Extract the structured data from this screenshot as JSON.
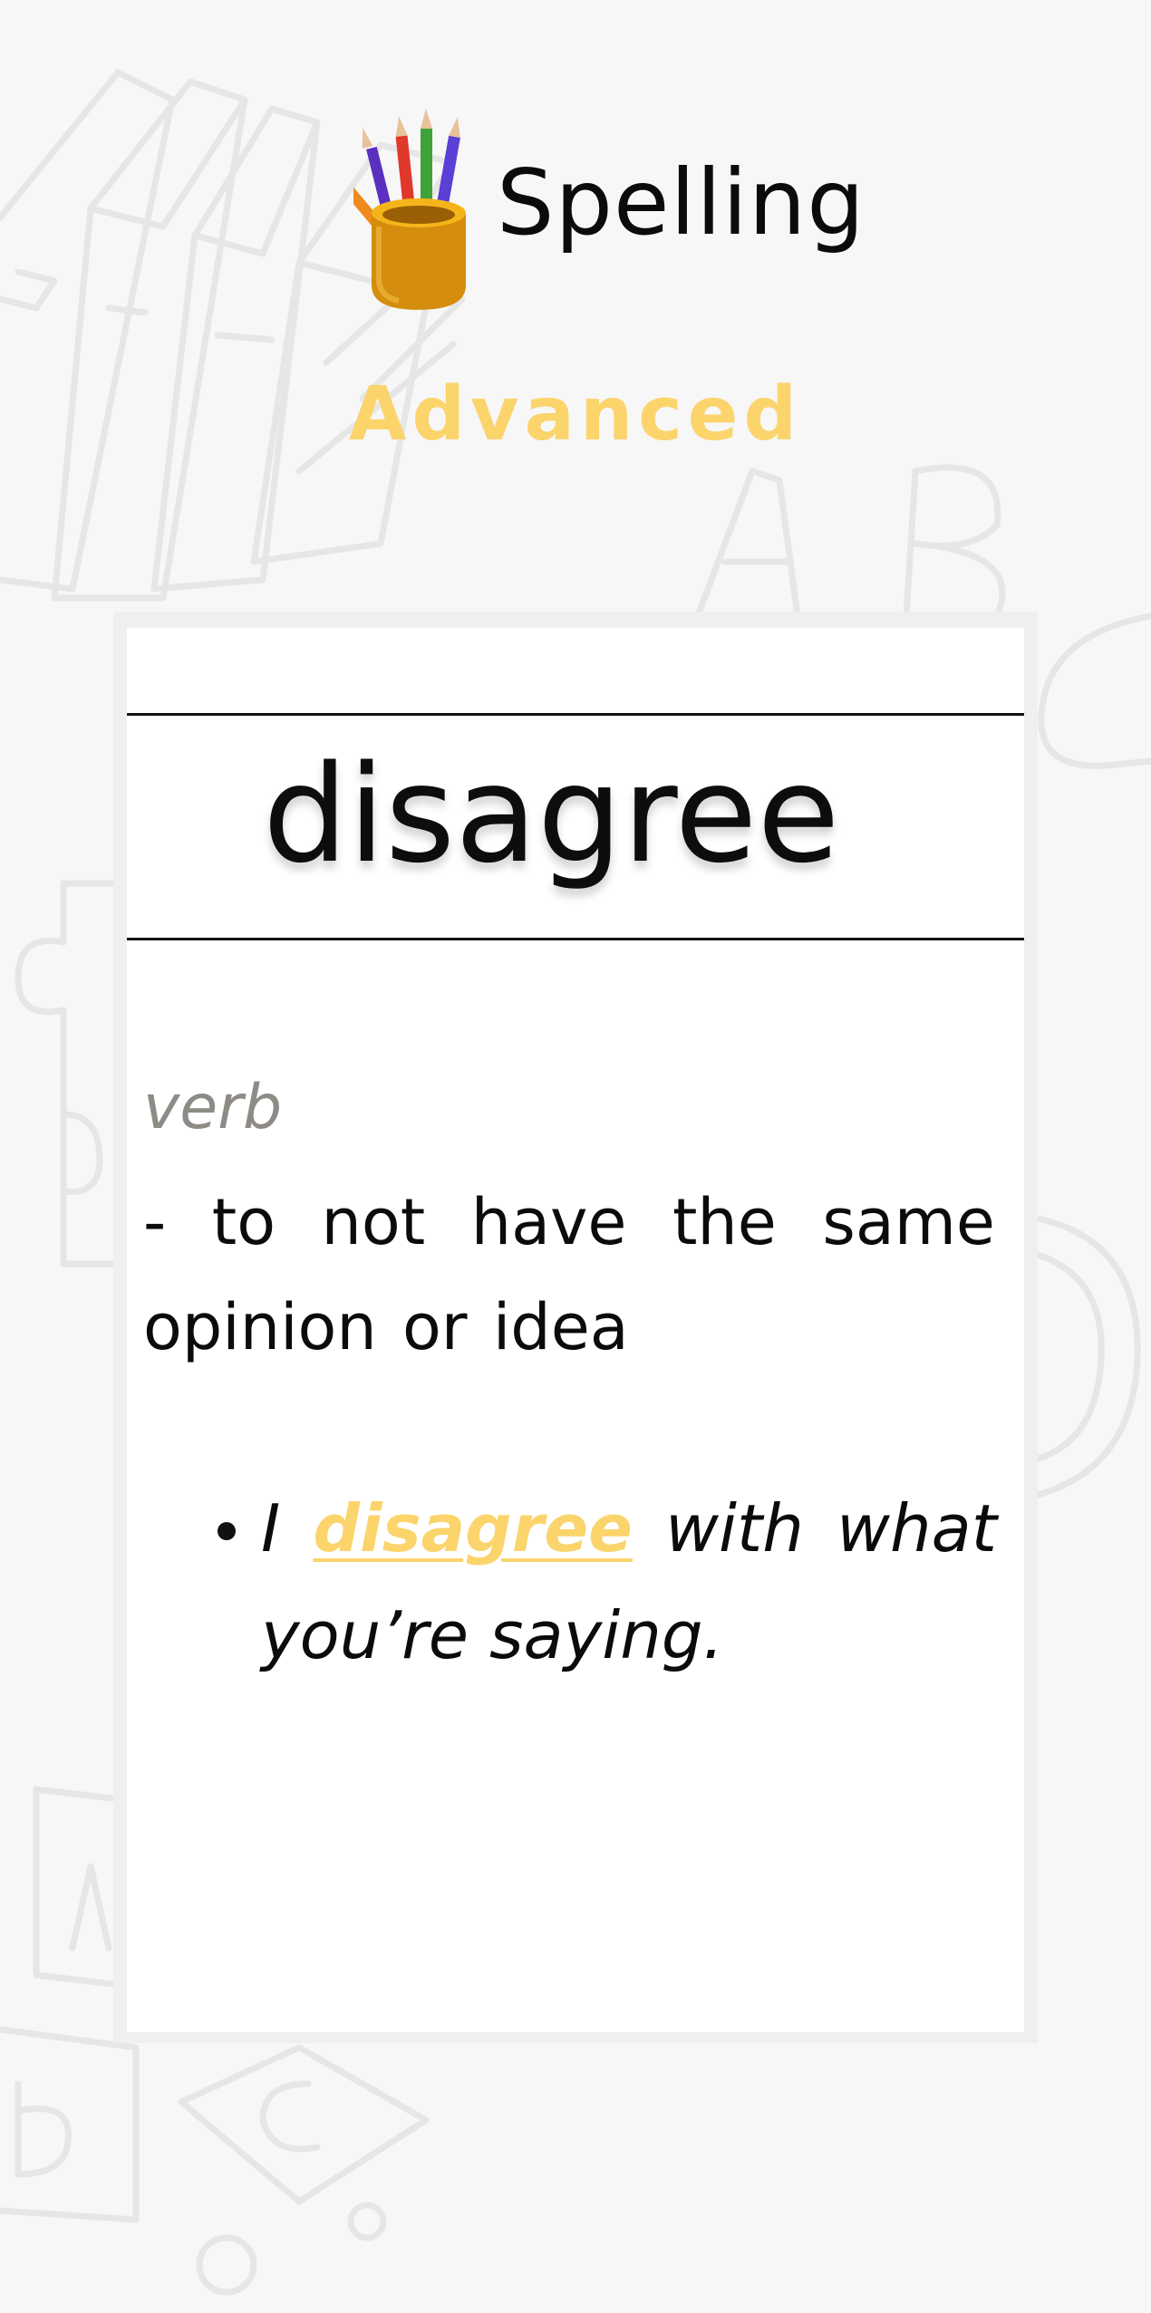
{
  "header": {
    "title": "Spelling",
    "icon": "pencil-cup-icon",
    "level": "Advanced"
  },
  "card": {
    "word": "disagree",
    "part_of_speech": "verb",
    "definition": "- to not have the same opinion or idea",
    "example": {
      "before": "I ",
      "highlight": "disagree",
      "after": " with what you’re saying."
    }
  },
  "colors": {
    "accent": "#fbd46c",
    "text": "#0b0b0b",
    "muted": "#8e8a86",
    "background": "#f7f7f7",
    "card": "#ffffff"
  }
}
